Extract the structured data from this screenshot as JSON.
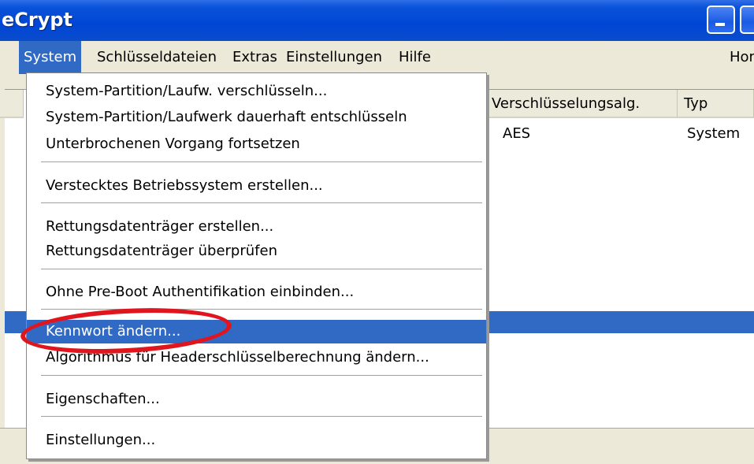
{
  "window": {
    "title": "eCrypt"
  },
  "menubar": {
    "items": [
      "System",
      "Schlüsseldateien",
      "Extras",
      "Einstellungen",
      "Hilfe"
    ],
    "right_link": "Hom"
  },
  "table": {
    "columns": [
      "Verschlüsselungsalg.",
      "Typ"
    ],
    "rows": [
      {
        "algorithm": "AES",
        "type": "System"
      }
    ]
  },
  "system_menu": {
    "items": [
      "System-Partition/Laufw. verschlüsseln...",
      "System-Partition/Laufwerk dauerhaft entschlüsseln",
      "Unterbrochenen Vorgang fortsetzen",
      "Verstecktes Betriebssystem erstellen...",
      "Rettungsdatenträger erstellen...",
      "Rettungsdatenträger überprüfen",
      "Ohne Pre-Boot Authentifikation einbinden...",
      "Kennwort ändern...",
      "Algorithmus für Headerschlüsselberechnung ändern...",
      "Eigenschaften...",
      "Einstellungen..."
    ],
    "highlighted_index": 7
  },
  "colors": {
    "titlebar": "#0046d5",
    "menu_highlight": "#316ac5",
    "annotation": "#e0161e"
  }
}
